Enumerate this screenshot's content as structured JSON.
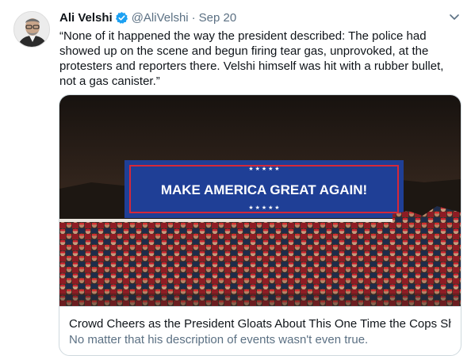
{
  "tweet": {
    "author_name": "Ali Velshi",
    "verified": true,
    "handle": "@AliVelshi",
    "separator": "·",
    "date": "Sep 20",
    "text": "“None of it happened the way the president described: The police had showed up on the scene and begun firing tear gas, unprovoked, at the protesters and reporters there. Velshi himself was hit with a rubber bullet, not a gas canister.”",
    "menu_icon": "chevron-down-icon"
  },
  "card": {
    "banner_text": "MAKE AMERICA GREAT AGAIN!",
    "title": "Crowd Cheers as the President Gloats About This One Time the Cops Sh...",
    "description": "No matter that his description of events wasn't even true."
  },
  "colors": {
    "verified_blue": "#1da1f2",
    "secondary_text": "#5b7083",
    "banner_blue": "#1f3f96",
    "banner_red": "#d62839"
  }
}
